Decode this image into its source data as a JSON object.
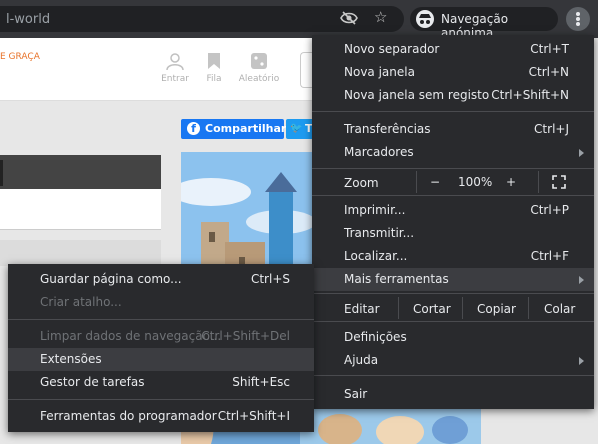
{
  "browser": {
    "url_fragment": "l-world",
    "incognito_label": "Navegação anónima"
  },
  "site": {
    "tagline": "E GRAÇA",
    "nav": [
      {
        "label": "Entrar",
        "icon": "user-icon"
      },
      {
        "label": "Fila",
        "icon": "bookmark-icon"
      },
      {
        "label": "Aleatório",
        "icon": "dice-icon"
      }
    ],
    "share": {
      "facebook": "Compartilhar",
      "twitter": "T"
    }
  },
  "main_menu": {
    "items": {
      "new_tab": {
        "label": "Novo separador",
        "shortcut": "Ctrl+T"
      },
      "new_window": {
        "label": "Nova janela",
        "shortcut": "Ctrl+N"
      },
      "new_incognito": {
        "label": "Nova janela sem registo",
        "shortcut": "Ctrl+Shift+N"
      },
      "downloads": {
        "label": "Transferências",
        "shortcut": "Ctrl+J"
      },
      "bookmarks": {
        "label": "Marcadores"
      },
      "print": {
        "label": "Imprimir...",
        "shortcut": "Ctrl+P"
      },
      "cast": {
        "label": "Transmitir..."
      },
      "find": {
        "label": "Localizar...",
        "shortcut": "Ctrl+F"
      },
      "more_tools": {
        "label": "Mais ferramentas"
      },
      "settings": {
        "label": "Definições"
      },
      "help": {
        "label": "Ajuda"
      },
      "exit": {
        "label": "Sair"
      }
    },
    "zoom": {
      "label": "Zoom",
      "minus": "−",
      "value": "100%",
      "plus": "+"
    },
    "edit": {
      "label": "Editar",
      "cut": "Cortar",
      "copy": "Copiar",
      "paste": "Colar"
    }
  },
  "submenu": {
    "items": {
      "save_page": {
        "label": "Guardar página como...",
        "shortcut": "Ctrl+S"
      },
      "create_shortcut": {
        "label": "Criar atalho..."
      },
      "clear_data": {
        "label": "Limpar dados de navegação...",
        "shortcut": "Ctrl+Shift+Del"
      },
      "extensions": {
        "label": "Extensões"
      },
      "task_manager": {
        "label": "Gestor de tarefas",
        "shortcut": "Shift+Esc"
      },
      "dev_tools": {
        "label": "Ferramentas do programador",
        "shortcut": "Ctrl+Shift+I"
      }
    }
  },
  "colors": {
    "menu_bg": "#292a2d",
    "highlight": "#3c3d41",
    "accent_orange": "#e8732a",
    "facebook": "#1877f2",
    "twitter": "#1d9bf0"
  }
}
